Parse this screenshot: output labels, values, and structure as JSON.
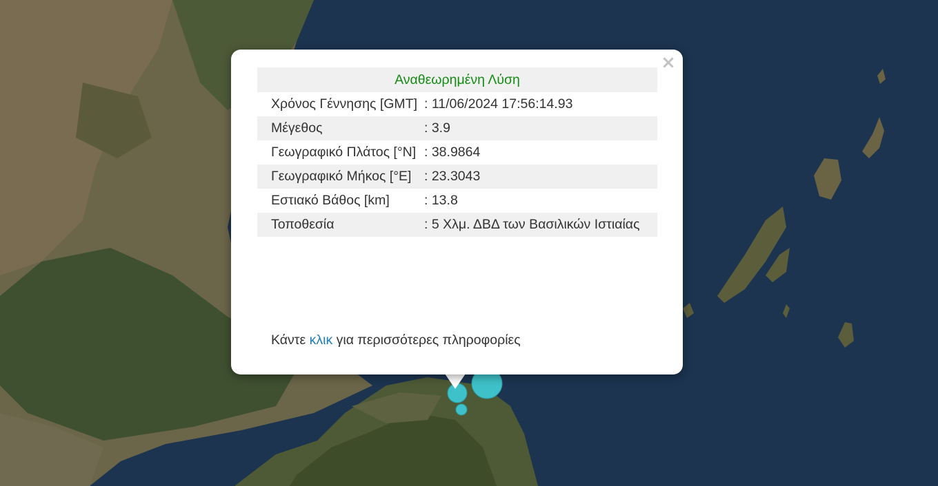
{
  "popup": {
    "title": "Αναθεωρημένη Λύση",
    "close_label": "×",
    "rows": [
      {
        "label": "Χρόνος Γέννησης [GMT]",
        "value": ": 11/06/2024 17:56:14.93"
      },
      {
        "label": "Μέγεθος",
        "value": ": 3.9"
      },
      {
        "label": "Γεωγραφικό Πλάτος [°N]",
        "value": ": 38.9864"
      },
      {
        "label": "Γεωγραφικό Μήκος [°E]",
        "value": ": 23.3043"
      },
      {
        "label": "Εστιακό Βάθος [km]",
        "value": ": 13.8"
      },
      {
        "label": "Τοποθεσία",
        "value": ": 5 Χλμ. ΔΒΔ των Βασιλικών Ιστιαίας"
      }
    ],
    "footer_prefix": "Κάντε",
    "footer_link": "κλικ",
    "footer_suffix": "για περισσότερες πληροφορίες"
  },
  "markers_color": "#3fc1c9"
}
